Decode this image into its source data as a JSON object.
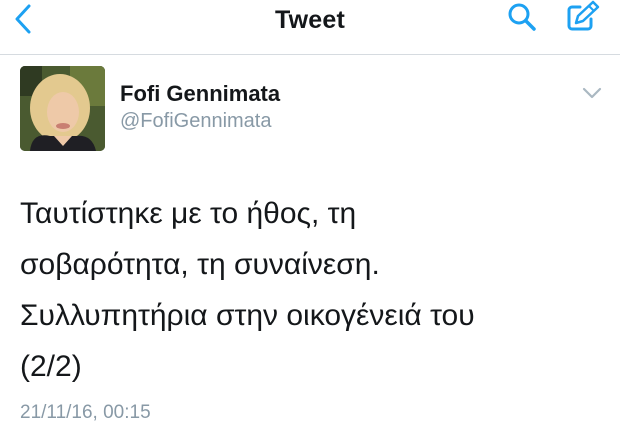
{
  "navbar": {
    "title": "Tweet",
    "back_icon": "chevron-left-icon",
    "search_icon": "search-icon",
    "compose_icon": "compose-icon"
  },
  "tweet": {
    "author_name": "Fofi Gennimata",
    "author_handle": "@FofiGennimata",
    "text": "Ταυτίστηκε με το ήθος, τη\nσοβαρότητα, τη συναίνεση.\nΣυλλυπητήρια στην οικογένειά του\n(2/2)",
    "timestamp": "21/11/16, 00:15",
    "menu_icon": "chevron-down-icon"
  },
  "colors": {
    "accent": "#1da1f2",
    "text": "#14171a",
    "secondary_text": "#8899a6",
    "divider": "#d6dbe0"
  }
}
